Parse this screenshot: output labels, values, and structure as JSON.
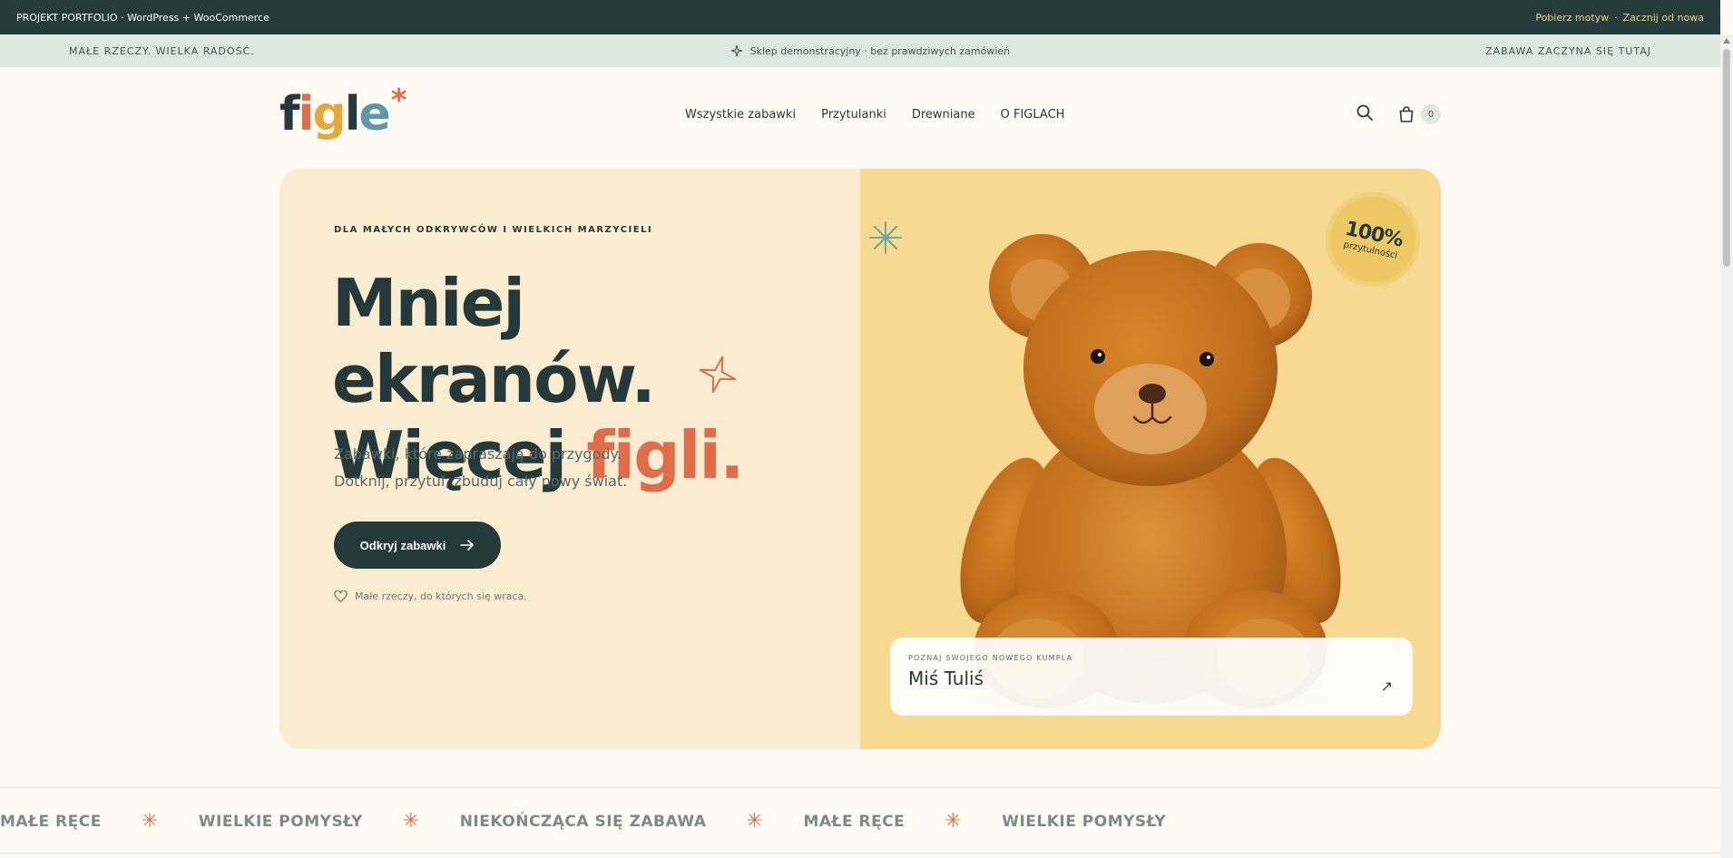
{
  "topbar": {
    "left_text": "PROJEKT PORTFOLIO · WordPress + WooCommerce",
    "link1": "Pobierz motyw",
    "sep": "·",
    "link2": "Zacznij od nowa"
  },
  "announce": {
    "left": "MAŁE RZECZY. WIELKA RADOŚĆ.",
    "center": "Sklep demonstracyjny · bez prawdziwych zamówień",
    "right": "ZABAWA ZACZYNA SIĘ TUTAJ"
  },
  "header": {
    "logo": {
      "f": "f",
      "i": "i",
      "g": "g",
      "l": "l",
      "e": "e",
      "star": "*"
    },
    "nav": [
      {
        "label": "Wszystkie zabawki"
      },
      {
        "label": "Przytulanki"
      },
      {
        "label": "Drewniane"
      },
      {
        "label": "O FIGLACH"
      }
    ],
    "cart_count": "0"
  },
  "hero": {
    "eyebrow": "DLA MAŁYCH ODKRYWCÓW I WIELKICH MARZYCIELI",
    "headline_line1": "Mniej ekranów.",
    "headline_line2_a": "Więcej ",
    "headline_line2_b": "figli.",
    "sub_line1": "Zabawki, które zapraszają do przygody.",
    "sub_line2": "Dotknij, przytul, zbuduj cały nowy świat.",
    "cta": "Odkryj zabawki",
    "note": "Małe rzeczy, do których się wraca.",
    "stamp_big": "100%",
    "stamp_small": "przytulności",
    "card_kicker": "POZNAJ SWOJEGO NOWEGO KUMPLA",
    "card_name": "Miś Tuliś",
    "card_arrow": "↗"
  },
  "marquee": [
    "MAŁE RĘCE",
    "WIELKIE POMYSŁY",
    "NIEKOŃCZĄCA SIĘ ZABAWA",
    "MAŁE RĘCE",
    "WIELKIE POMYSŁY"
  ],
  "colors": {
    "dark": "#25393a",
    "accent": "#e06c4a",
    "mint": "#dde8df",
    "cream": "#f9ecd0",
    "honey": "#f7d992"
  }
}
